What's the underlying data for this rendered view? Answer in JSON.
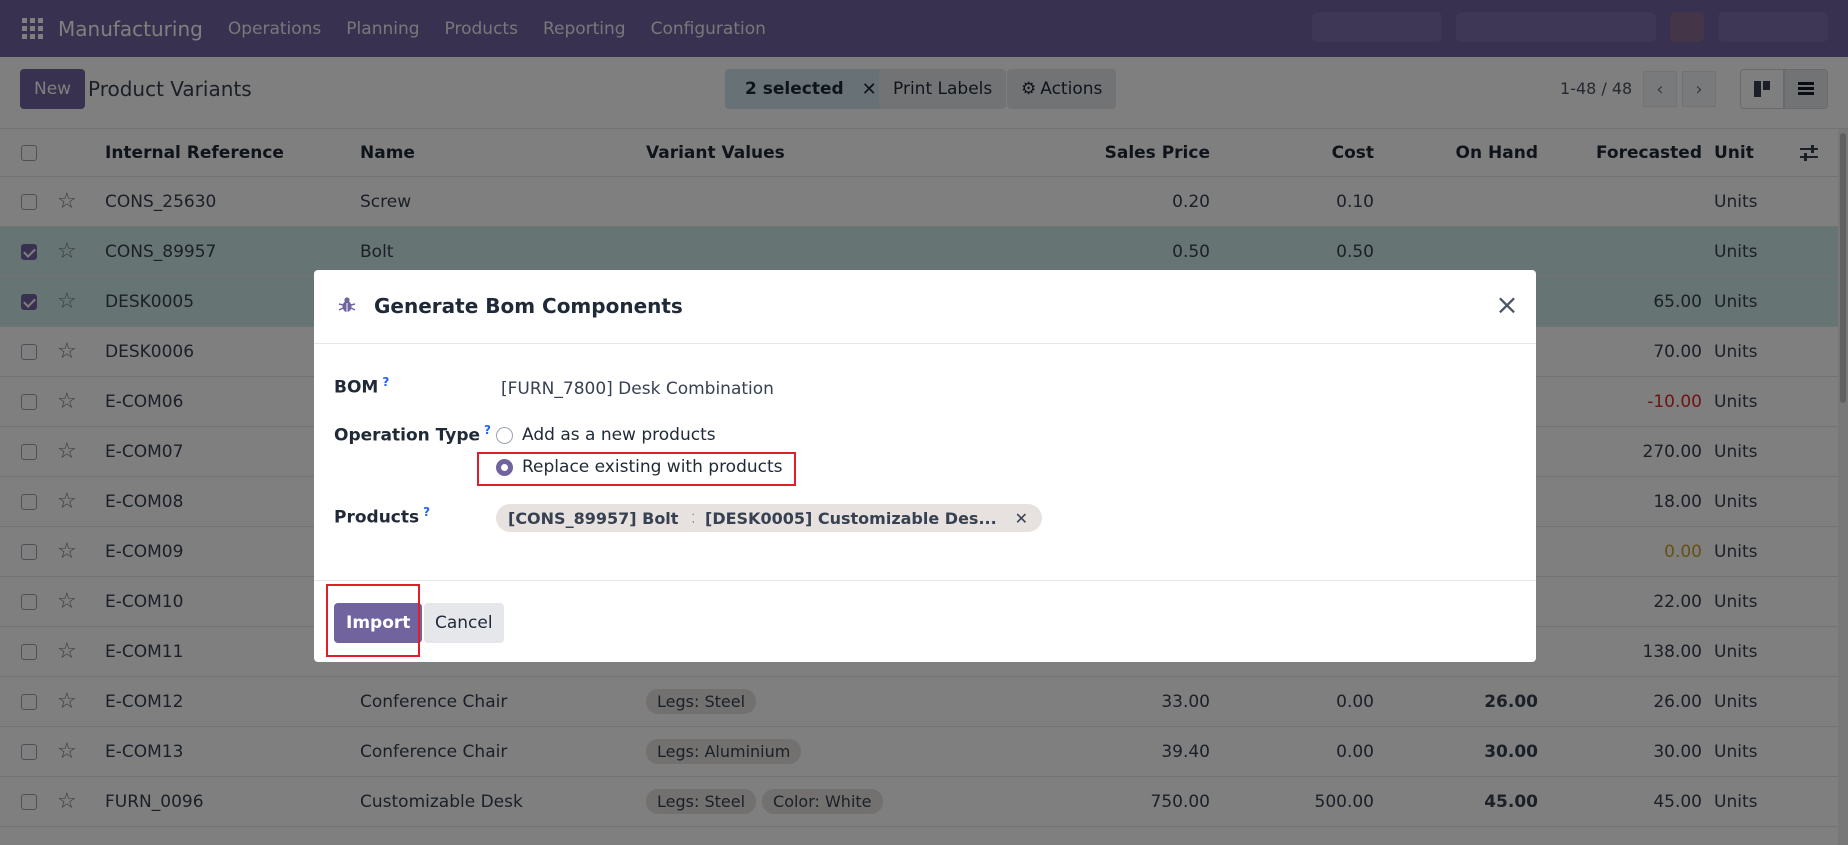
{
  "navbar": {
    "brand": "Manufacturing",
    "menu": [
      "Operations",
      "Planning",
      "Products",
      "Reporting",
      "Configuration"
    ]
  },
  "control": {
    "new_label": "New",
    "title": "Product Variants",
    "selected_label": "2 selected",
    "print_labels": "Print Labels",
    "actions": "Actions",
    "pager": "1-48 / 48"
  },
  "list": {
    "columns": [
      "Internal Reference",
      "Name",
      "Variant Values",
      "Sales Price",
      "Cost",
      "On Hand",
      "Forecasted",
      "Unit"
    ],
    "rows": [
      {
        "ref": "CONS_25630",
        "name": "Screw",
        "tags": [],
        "price": "0.20",
        "cost": "0.10",
        "onhand": "",
        "forecast": "",
        "unit": "Units",
        "selected": false
      },
      {
        "ref": "CONS_89957",
        "name": "Bolt",
        "tags": [],
        "price": "0.50",
        "cost": "0.50",
        "onhand": "",
        "forecast": "",
        "unit": "Units",
        "selected": true
      },
      {
        "ref": "DESK0005",
        "name": "",
        "tags": [],
        "price": "",
        "cost": "",
        "onhand": "",
        "forecast": "65.00",
        "unit": "Units",
        "selected": true
      },
      {
        "ref": "DESK0006",
        "name": "",
        "tags": [],
        "price": "",
        "cost": "",
        "onhand": "",
        "forecast": "70.00",
        "unit": "Units",
        "selected": false
      },
      {
        "ref": "E-COM06",
        "name": "",
        "tags": [],
        "price": "",
        "cost": "",
        "onhand": "",
        "forecast": "-10.00",
        "unit": "Units",
        "selected": false
      },
      {
        "ref": "E-COM07",
        "name": "",
        "tags": [],
        "price": "",
        "cost": "",
        "onhand": "",
        "forecast": "270.00",
        "unit": "Units",
        "selected": false
      },
      {
        "ref": "E-COM08",
        "name": "",
        "tags": [],
        "price": "",
        "cost": "",
        "onhand": "",
        "forecast": "18.00",
        "unit": "Units",
        "selected": false
      },
      {
        "ref": "E-COM09",
        "name": "",
        "tags": [],
        "price": "",
        "cost": "",
        "onhand": "",
        "forecast": "0.00",
        "unit": "Units",
        "selected": false
      },
      {
        "ref": "E-COM10",
        "name": "",
        "tags": [],
        "price": "",
        "cost": "",
        "onhand": "",
        "forecast": "22.00",
        "unit": "Units",
        "selected": false
      },
      {
        "ref": "E-COM11",
        "name": "",
        "tags": [],
        "price": "",
        "cost": "",
        "onhand": "",
        "forecast": "138.00",
        "unit": "Units",
        "selected": false
      },
      {
        "ref": "E-COM12",
        "name": "Conference Chair",
        "tags": [
          "Legs: Steel"
        ],
        "price": "33.00",
        "cost": "0.00",
        "onhand": "26.00",
        "forecast": "26.00",
        "unit": "Units",
        "selected": false
      },
      {
        "ref": "E-COM13",
        "name": "Conference Chair",
        "tags": [
          "Legs: Aluminium"
        ],
        "price": "39.40",
        "cost": "0.00",
        "onhand": "30.00",
        "forecast": "30.00",
        "unit": "Units",
        "selected": false
      },
      {
        "ref": "FURN_0096",
        "name": "Customizable Desk",
        "tags": [
          "Legs: Steel",
          "Color: White"
        ],
        "price": "750.00",
        "cost": "500.00",
        "onhand": "45.00",
        "forecast": "45.00",
        "unit": "Units",
        "selected": false
      }
    ]
  },
  "dialog": {
    "title": "Generate Bom Components",
    "bom_label": "BOM",
    "bom_value": "[FURN_7800] Desk Combination",
    "operation_label": "Operation Type",
    "option_add": "Add as a new products",
    "option_replace": "Replace existing with products",
    "products_label": "Products",
    "products": [
      "[CONS_89957] Bolt",
      "[DESK0005] Customizable Des..."
    ],
    "help_mark": "?",
    "import_label": "Import",
    "cancel_label": "Cancel"
  },
  "colors": {
    "brand": "#71639e",
    "selected_row": "#cfe8e8",
    "highlight": "#e11d2a"
  }
}
